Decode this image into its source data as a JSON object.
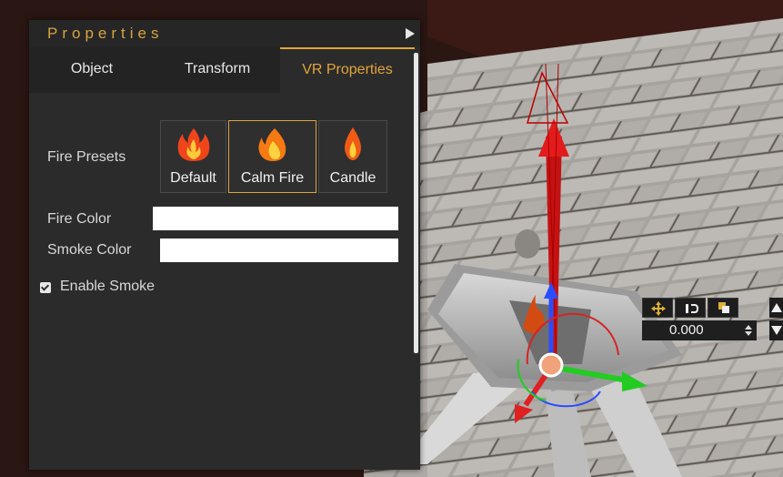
{
  "panel": {
    "title": "Properties",
    "collapse_icon": "triangle-right-icon"
  },
  "tabs": [
    {
      "label": "Object",
      "active": false
    },
    {
      "label": "Transform",
      "active": false
    },
    {
      "label": "VR Properties",
      "active": true
    }
  ],
  "fire_presets": {
    "label": "Fire Presets",
    "options": [
      {
        "label": "Default",
        "icon": "fire-icon",
        "selected": false
      },
      {
        "label": "Calm Fire",
        "icon": "flame-icon",
        "selected": true
      },
      {
        "label": "Candle",
        "icon": "candle-flame-icon",
        "selected": false
      }
    ]
  },
  "fire_color": {
    "label": "Fire Color",
    "value": "#ffffff"
  },
  "smoke_color": {
    "label": "Smoke Color",
    "value": "#ffffff"
  },
  "enable_smoke": {
    "label": "Enable Smoke",
    "checked": true
  },
  "gizmo": {
    "buttons": [
      "move-icon",
      "snap-icon",
      "pivot-icon",
      "up-arrow-icon"
    ],
    "value": "0.000"
  },
  "colors": {
    "accent": "#d9a441",
    "panel_bg": "#2b2b2b",
    "axis_x": "#e02020",
    "axis_y": "#2a4dff",
    "axis_z": "#22cc22"
  }
}
